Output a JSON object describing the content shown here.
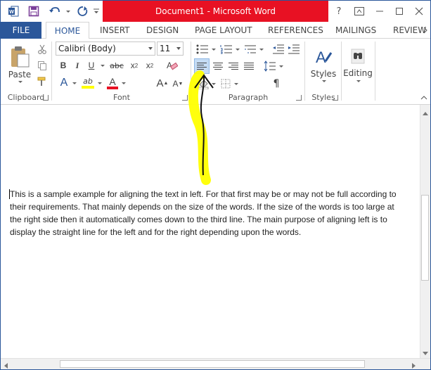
{
  "title": {
    "text": "Document1 - Microsoft Word",
    "help": "?"
  },
  "tabs": [
    "FILE",
    "HOME",
    "INSERT",
    "DESIGN",
    "PAGE LAYOUT",
    "REFERENCES",
    "MAILINGS",
    "REVIEW"
  ],
  "ribbon": {
    "clipboard": {
      "label": "Clipboard",
      "paste": "Paste"
    },
    "font": {
      "label": "Font",
      "font_name": "Calibri (Body)",
      "font_size": "11",
      "bold": "B",
      "italic": "I",
      "underline": "U",
      "strike": "abc",
      "subscript": "x",
      "subscript_mark": "2",
      "superscript": "x",
      "superscript_mark": "2",
      "grow": "A",
      "shrink": "A",
      "text_effects": "A",
      "highlight": "ab",
      "font_color": "A"
    },
    "paragraph": {
      "label": "Paragraph",
      "show_marks": "¶"
    },
    "styles": {
      "label": "Styles",
      "button": "Styles"
    },
    "editing": {
      "button": "Editing"
    }
  },
  "document": {
    "text": "This is a sample example for aligning the text in left. For that first may be or may not be full according to their requirements. That mainly depends on the size of the words. If the size of the words is too large at the right side then it automatically comes down to the third line. The main purpose of aligning left is to display the straight line for the left and for the right depending upon the words."
  },
  "colors": {
    "accent": "#2b579a",
    "title_active": "#e81123",
    "highlight": "#ffff00",
    "font_color": "#e81123"
  },
  "icons": [
    "word-logo-icon",
    "save-icon",
    "undo-icon",
    "redo-icon",
    "customize-qat-icon",
    "help-icon",
    "ribbon-display-icon",
    "minimize-icon",
    "maximize-icon",
    "close-icon"
  ]
}
